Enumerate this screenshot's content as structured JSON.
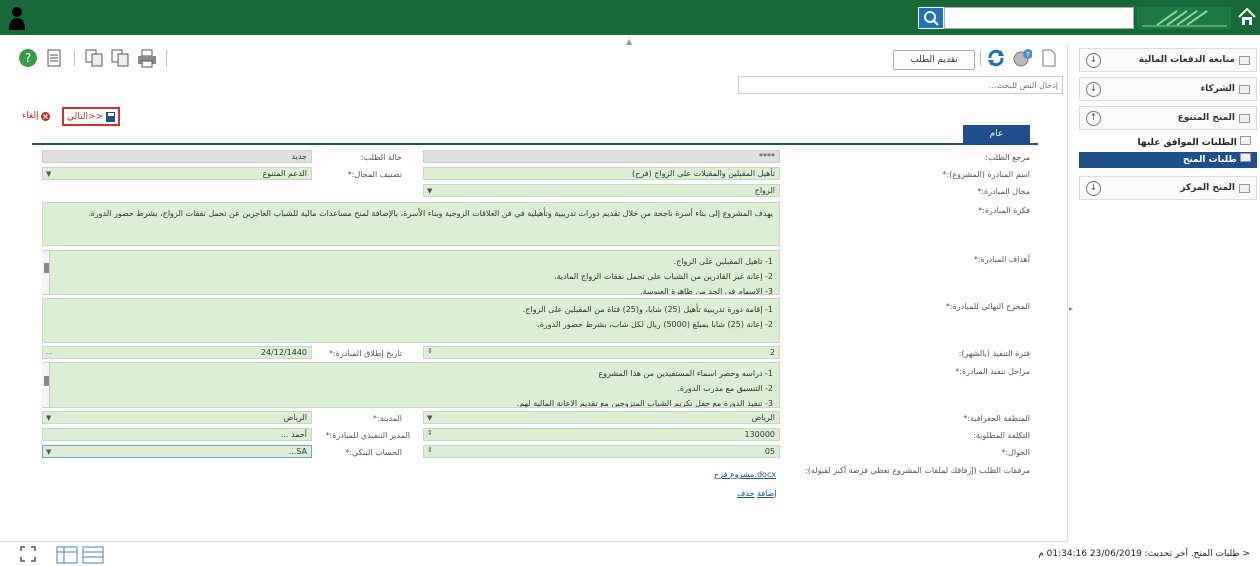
{
  "header": {
    "search_placeholder": ""
  },
  "toolbar": {
    "submit_label": "تقديم الطلب"
  },
  "doc_search": {
    "placeholder": "إدخال النص للبحث..."
  },
  "actions": {
    "next_label": "التالي>>",
    "cancel_label": "إلغاء"
  },
  "tab": {
    "general": "عام"
  },
  "form": {
    "ref_label": "مرجع الطلب:",
    "ref_value": "****",
    "status_label": "حالة الطلب:",
    "status_value": "جديد",
    "name_label": "اسم المبادرة (المشروع):*",
    "name_value": "تأهيل المقبلين والمقبلات على الزواج (فرح)",
    "category_label": "تصنيف المجال:*",
    "category_value": "الدعم المتنوع",
    "field_label": "مجال المبادرة:*",
    "field_value": "الزواج",
    "idea_label": "فكرة المبادرة:*",
    "idea_value": "يهدف المشروع إلى بناء أسرة ناجحة من خلال تقديم دورات تدريبية وتأهيلية في فن العلاقات الزوجية وبناء الأسرة، بالإضافة لمنح مساعدات مالية للشباب العاجزين عن تحمل نفقات الزواج، بشرط حضور الدورة.",
    "goals_label": "أهداف المبادرة:*",
    "goals": [
      "1- تاهيل المقبلين على الزواج.",
      "2- إعانة غير القادرين من الشباب على تحمل نفقات الزواج المادية.",
      "3- الإسهام في الحد من ظاهرة العنوسة."
    ],
    "output_label": "المخرج النهائي للمبادرة:*",
    "outputs": [
      "1- إقامة دورة تدريبية تأهيل (25) شابا، و(25) فتاة من المقبلين على الزواج.",
      "2- إعانة (25) شابا بمبلغ (5000) ريال لكل شاب، بشرط حضور الدورة."
    ],
    "duration_label": "فترة التنفيذ (بالشهر):",
    "duration_value": "2",
    "launch_label": "تاريخ إطلاق المبادرة:*",
    "launch_value": "24/12/1440",
    "stages_label": "مراحل تنفيذ المبادرة:*",
    "stages": [
      "1- دراسه وحصر اسماء المستفيدين من هذا المشروع",
      "2- التنسيق مع مدرب الدورة.",
      "3- تنفيذ الدورة مع حفل تكريم الشباب المتزوجين مع تقديم الاعانة المالية لهم."
    ],
    "region_label": "المنطقة الجغرافية:*",
    "region_value": "الرياض",
    "city_label": "المدينة:*",
    "city_value": "الرياض",
    "cost_label": "التكلفة المطلوبة:",
    "cost_value": "130000",
    "manager_label": "المدير التنفيذي للمبادرة:*",
    "manager_value": "أحمد ...",
    "mobile_label": "الجوال:*",
    "mobile_value": "05",
    "bank_label": "الحساب البنكي:*",
    "bank_value": "SA...",
    "attach_label": "مرفقات الطلب (إرفاقك لملفات المشروع تعطي فرصة أكبر لقبوله):",
    "attach_file": "مشروع فرح.docx",
    "add_label": "إضافة",
    "delete_label": "حذف"
  },
  "status_bar": {
    "text": "< طلبات المنح. آخر تحديث: 23/06/2019 01:34:16 م"
  },
  "sidebar": {
    "items": [
      {
        "label": "متابعة الدفعات المالية"
      },
      {
        "label": "الشركاء"
      },
      {
        "label": "المنح المتنوع"
      },
      {
        "label": "الطلبات الموافق عليها"
      },
      {
        "label": "طلبات المنح"
      },
      {
        "label": "المنح المركز"
      }
    ]
  },
  "colors": {
    "topbar": "#17693a",
    "tab": "#1f4e8c",
    "field": "#dcefd4",
    "highlight": "#d32f2f"
  }
}
